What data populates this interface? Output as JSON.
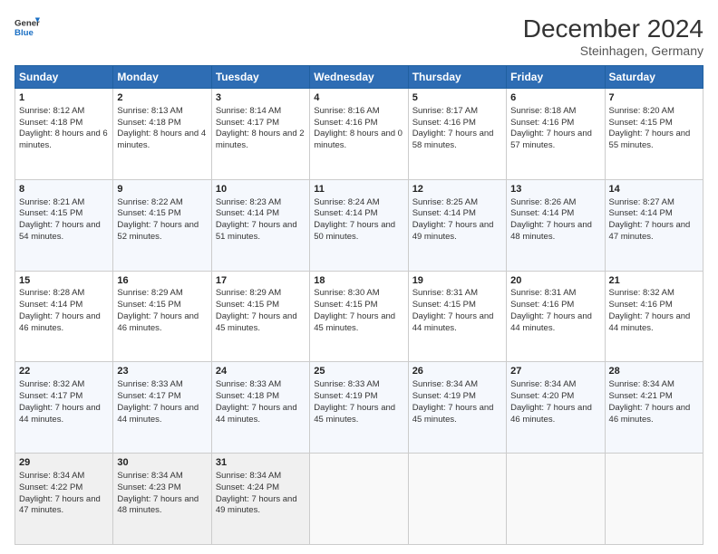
{
  "logo": {
    "line1": "General",
    "line2": "Blue"
  },
  "title": "December 2024",
  "subtitle": "Steinhagen, Germany",
  "days_of_week": [
    "Sunday",
    "Monday",
    "Tuesday",
    "Wednesday",
    "Thursday",
    "Friday",
    "Saturday"
  ],
  "weeks": [
    [
      {
        "day": 1,
        "rise": "8:12 AM",
        "set": "4:18 PM",
        "daylight": "8 hours and 6 minutes."
      },
      {
        "day": 2,
        "rise": "8:13 AM",
        "set": "4:18 PM",
        "daylight": "8 hours and 4 minutes."
      },
      {
        "day": 3,
        "rise": "8:14 AM",
        "set": "4:17 PM",
        "daylight": "8 hours and 2 minutes."
      },
      {
        "day": 4,
        "rise": "8:16 AM",
        "set": "4:16 PM",
        "daylight": "8 hours and 0 minutes."
      },
      {
        "day": 5,
        "rise": "8:17 AM",
        "set": "4:16 PM",
        "daylight": "7 hours and 58 minutes."
      },
      {
        "day": 6,
        "rise": "8:18 AM",
        "set": "4:16 PM",
        "daylight": "7 hours and 57 minutes."
      },
      {
        "day": 7,
        "rise": "8:20 AM",
        "set": "4:15 PM",
        "daylight": "7 hours and 55 minutes."
      }
    ],
    [
      {
        "day": 8,
        "rise": "8:21 AM",
        "set": "4:15 PM",
        "daylight": "7 hours and 54 minutes."
      },
      {
        "day": 9,
        "rise": "8:22 AM",
        "set": "4:15 PM",
        "daylight": "7 hours and 52 minutes."
      },
      {
        "day": 10,
        "rise": "8:23 AM",
        "set": "4:14 PM",
        "daylight": "7 hours and 51 minutes."
      },
      {
        "day": 11,
        "rise": "8:24 AM",
        "set": "4:14 PM",
        "daylight": "7 hours and 50 minutes."
      },
      {
        "day": 12,
        "rise": "8:25 AM",
        "set": "4:14 PM",
        "daylight": "7 hours and 49 minutes."
      },
      {
        "day": 13,
        "rise": "8:26 AM",
        "set": "4:14 PM",
        "daylight": "7 hours and 48 minutes."
      },
      {
        "day": 14,
        "rise": "8:27 AM",
        "set": "4:14 PM",
        "daylight": "7 hours and 47 minutes."
      }
    ],
    [
      {
        "day": 15,
        "rise": "8:28 AM",
        "set": "4:14 PM",
        "daylight": "7 hours and 46 minutes."
      },
      {
        "day": 16,
        "rise": "8:29 AM",
        "set": "4:15 PM",
        "daylight": "7 hours and 46 minutes."
      },
      {
        "day": 17,
        "rise": "8:29 AM",
        "set": "4:15 PM",
        "daylight": "7 hours and 45 minutes."
      },
      {
        "day": 18,
        "rise": "8:30 AM",
        "set": "4:15 PM",
        "daylight": "7 hours and 45 minutes."
      },
      {
        "day": 19,
        "rise": "8:31 AM",
        "set": "4:15 PM",
        "daylight": "7 hours and 44 minutes."
      },
      {
        "day": 20,
        "rise": "8:31 AM",
        "set": "4:16 PM",
        "daylight": "7 hours and 44 minutes."
      },
      {
        "day": 21,
        "rise": "8:32 AM",
        "set": "4:16 PM",
        "daylight": "7 hours and 44 minutes."
      }
    ],
    [
      {
        "day": 22,
        "rise": "8:32 AM",
        "set": "4:17 PM",
        "daylight": "7 hours and 44 minutes."
      },
      {
        "day": 23,
        "rise": "8:33 AM",
        "set": "4:17 PM",
        "daylight": "7 hours and 44 minutes."
      },
      {
        "day": 24,
        "rise": "8:33 AM",
        "set": "4:18 PM",
        "daylight": "7 hours and 44 minutes."
      },
      {
        "day": 25,
        "rise": "8:33 AM",
        "set": "4:19 PM",
        "daylight": "7 hours and 45 minutes."
      },
      {
        "day": 26,
        "rise": "8:34 AM",
        "set": "4:19 PM",
        "daylight": "7 hours and 45 minutes."
      },
      {
        "day": 27,
        "rise": "8:34 AM",
        "set": "4:20 PM",
        "daylight": "7 hours and 46 minutes."
      },
      {
        "day": 28,
        "rise": "8:34 AM",
        "set": "4:21 PM",
        "daylight": "7 hours and 46 minutes."
      }
    ],
    [
      {
        "day": 29,
        "rise": "8:34 AM",
        "set": "4:22 PM",
        "daylight": "7 hours and 47 minutes."
      },
      {
        "day": 30,
        "rise": "8:34 AM",
        "set": "4:23 PM",
        "daylight": "7 hours and 48 minutes."
      },
      {
        "day": 31,
        "rise": "8:34 AM",
        "set": "4:24 PM",
        "daylight": "7 hours and 49 minutes."
      },
      null,
      null,
      null,
      null
    ]
  ]
}
